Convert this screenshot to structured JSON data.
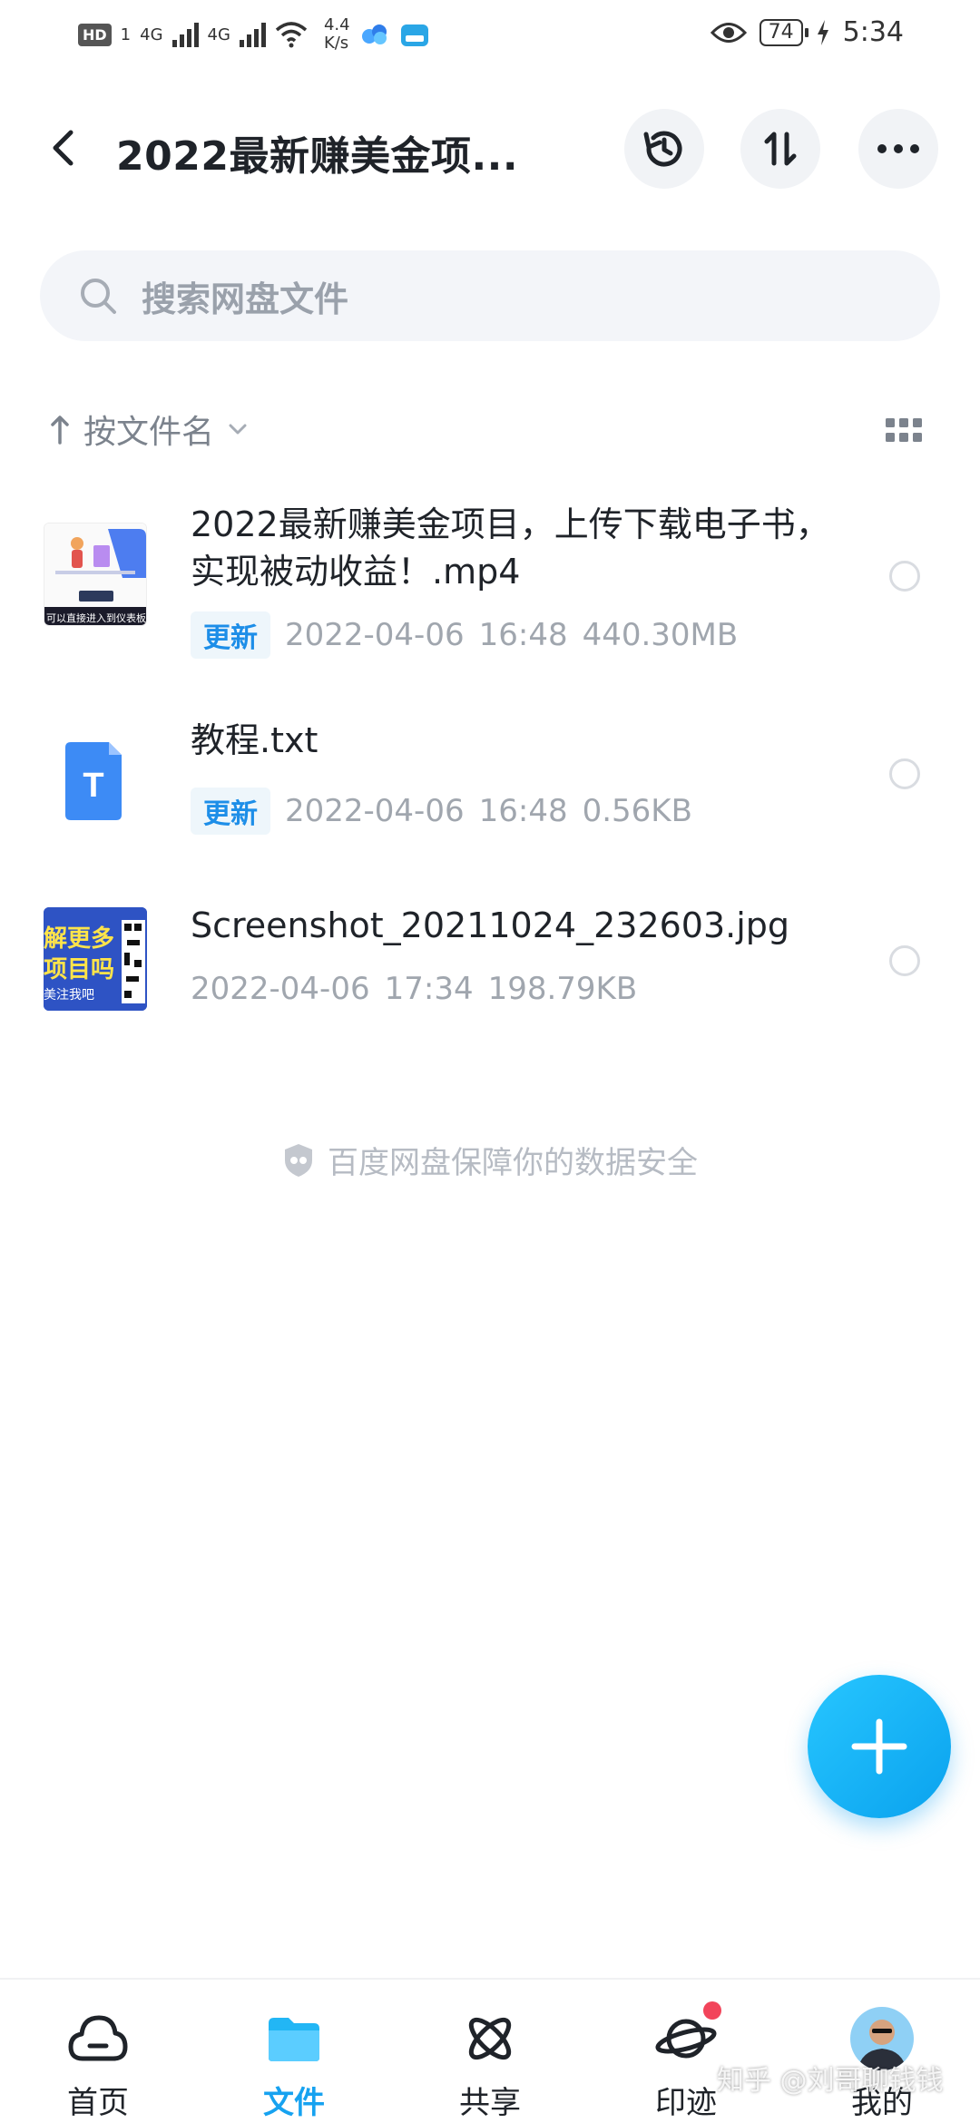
{
  "status_bar": {
    "hd": "HD",
    "sim": "1",
    "net1": "4G",
    "net2": "4G",
    "speed_value": "4.4",
    "speed_unit": "K/s",
    "battery": "74",
    "time": "5:34"
  },
  "header": {
    "title": "2022最新赚美金项...",
    "icons": {
      "back": "back-arrow-icon",
      "history": "history-icon",
      "transfer": "transfer-icon",
      "more": "more-icon"
    }
  },
  "search": {
    "placeholder": "搜索网盘文件"
  },
  "sort": {
    "label": "按文件名"
  },
  "files": [
    {
      "name": "2022最新赚美金项目，上传下载电子书，实现被动收益！.mp4",
      "badge": "更新",
      "date": "2022-04-06",
      "time": "16:48",
      "size": "440.30MB",
      "thumb_text": "可以直接进入到仪表板"
    },
    {
      "name": "教程.txt",
      "badge": "更新",
      "date": "2022-04-06",
      "time": "16:48",
      "size": "0.56KB",
      "icon_letter": "T"
    },
    {
      "name": "Screenshot_20211024_232603.jpg",
      "date": "2022-04-06",
      "time": "17:34",
      "size": "198.79KB",
      "thumb_line1": "解更多",
      "thumb_line2": "项目吗",
      "thumb_line3": "美注我吧"
    }
  ],
  "footer_note": "百度网盘保障你的数据安全",
  "tabs": [
    {
      "label": "首页",
      "icon": "cloud-icon"
    },
    {
      "label": "文件",
      "icon": "folder-icon",
      "active": true
    },
    {
      "label": "共享",
      "icon": "atom-icon"
    },
    {
      "label": "印迹",
      "icon": "planet-icon",
      "has_dot": true
    },
    {
      "label": "我的",
      "icon": "avatar"
    }
  ],
  "watermark": "知乎 @刘哥聊钱钱",
  "colors": {
    "accent": "#16a2f0",
    "badge_bg": "#eef6fb",
    "badge_text": "#1d8ee8",
    "notice_dot": "#f2445a"
  }
}
